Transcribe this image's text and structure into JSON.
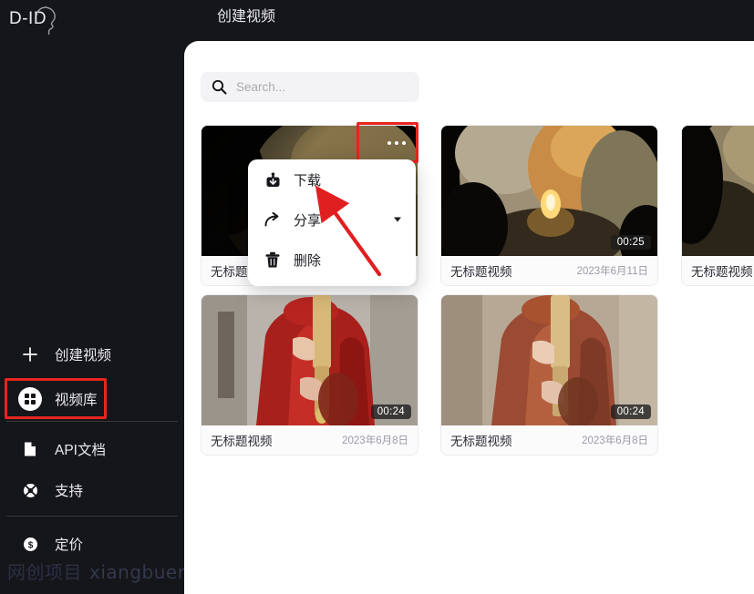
{
  "app": {
    "logo_text": "D-ID",
    "logo_icon": "head-profile-logo"
  },
  "header": {
    "title": "创建视频"
  },
  "sidebar": {
    "items": [
      {
        "label": "创建视频",
        "icon": "plus-icon",
        "active": false
      },
      {
        "label": "视频库",
        "icon": "grid-icon",
        "active": true
      },
      {
        "label": "API文档",
        "icon": "document-icon",
        "active": false
      },
      {
        "label": "支持",
        "icon": "lifebuoy-icon",
        "active": false
      },
      {
        "label": "定价",
        "icon": "dollar-circle-icon",
        "active": false
      }
    ]
  },
  "watermark": {
    "cn": "网创项目",
    "en": "xiangbuer.com"
  },
  "search": {
    "value": "",
    "placeholder": "Search...",
    "icon": "search-icon"
  },
  "cards": [
    {
      "title": "无标题视频",
      "date": "",
      "duration": "",
      "thumb_alt": "monk-in-olive-robe-dark"
    },
    {
      "title": "无标题视频",
      "date": "2023年6月11日",
      "duration": "00:25",
      "thumb_alt": "monk-holding-oil-lamp"
    },
    {
      "title": "无标题视频",
      "date": "",
      "duration": "",
      "thumb_alt": "monk-in-olive-robe-cropped"
    },
    {
      "title": "无标题视频",
      "date": "2023年6月8日",
      "duration": "00:24",
      "thumb_alt": "monk-red-robe-with-flute"
    },
    {
      "title": "无标题视频",
      "date": "2023年6月8日",
      "duration": "00:24",
      "thumb_alt": "monk-brown-robe-with-flute"
    }
  ],
  "context_menu": {
    "items": [
      {
        "label": "下载",
        "icon": "download-icon",
        "has_chevron": false
      },
      {
        "label": "分享",
        "icon": "share-arrow-icon",
        "has_chevron": true
      },
      {
        "label": "删除",
        "icon": "trash-icon",
        "has_chevron": false
      }
    ]
  },
  "annotations": {
    "highlight_color": "#e8241f",
    "arrow_color": "#e02020"
  }
}
